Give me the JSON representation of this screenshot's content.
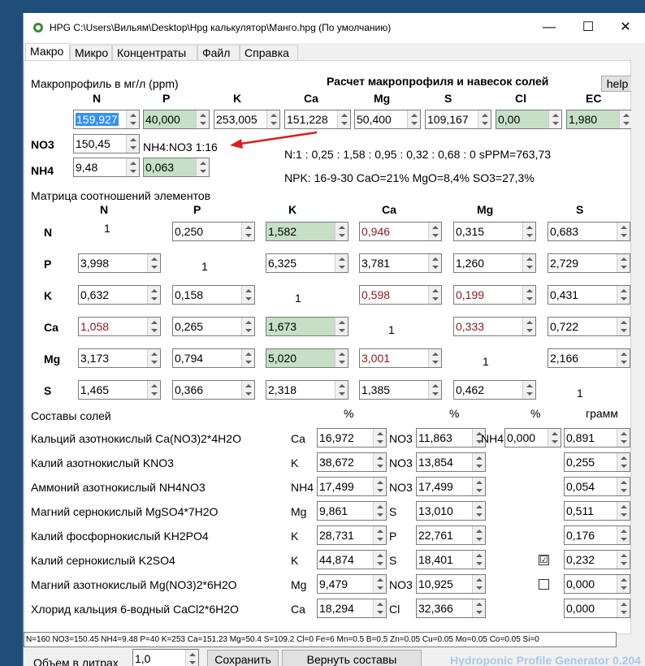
{
  "window": {
    "title": "HPG C:\\Users\\Вильям\\Desktop\\Hpg калькулятор\\Манго.hpg (По умолчанию)",
    "min": "—",
    "max": "☐",
    "close": "✕"
  },
  "tabs": [
    "Макро",
    "Микро",
    "Концентраты",
    "Файл",
    "Справка"
  ],
  "macro": {
    "profile_label": "Макропрофиль в мг/л (ppm)",
    "calc_title": "Расчет макропрофиля и навесок солей",
    "help": "help",
    "headers": [
      "N",
      "P",
      "K",
      "Ca",
      "Mg",
      "S",
      "Cl",
      "EC"
    ],
    "values": [
      "159,927",
      "40,000",
      "253,005",
      "151,228",
      "50,400",
      "109,167",
      "0,00",
      "1,980"
    ],
    "no3_label": "NO3",
    "no3_value": "150,45",
    "nh4_label": "NH4",
    "nh4_value": "9,48",
    "nh4_ratio_value": "0,063",
    "ratio_text": "NH4:NO3 1:16",
    "n_ratio": "N:1 : 0,25 : 1,58 : 0,95 : 0,32 : 0,68 : 0 sPPM=763,73",
    "npk": "NPK: 16-9-30 CaO=21% MgO=8,4% SO3=27,3%"
  },
  "matrix": {
    "title": "Матрица соотношений элементов",
    "cols": [
      "N",
      "P",
      "K",
      "Ca",
      "Mg",
      "S"
    ],
    "rows": [
      {
        "label": "N",
        "cells": [
          "1",
          "0,250",
          "1,582",
          "0,946",
          "0,315",
          "0,683"
        ]
      },
      {
        "label": "P",
        "cells": [
          "3,998",
          "1",
          "6,325",
          "3,781",
          "1,260",
          "2,729"
        ]
      },
      {
        "label": "K",
        "cells": [
          "0,632",
          "0,158",
          "1",
          "0,598",
          "0,199",
          "0,431"
        ]
      },
      {
        "label": "Ca",
        "cells": [
          "1,058",
          "0,265",
          "1,673",
          "1",
          "0,333",
          "0,722"
        ]
      },
      {
        "label": "Mg",
        "cells": [
          "3,173",
          "0,794",
          "5,020",
          "3,001",
          "1",
          "2,166"
        ]
      },
      {
        "label": "S",
        "cells": [
          "1,465",
          "0,366",
          "2,318",
          "1,385",
          "0,462",
          "1"
        ]
      }
    ]
  },
  "salts": {
    "title": "Составы солей",
    "pct1": "%",
    "pct2": "%",
    "pct3": "%",
    "gram": "грамм",
    "items": [
      {
        "name": "Кальций азотнокислый Ca(NO3)2*4H2O",
        "e1": "Ca",
        "v1": "16,972",
        "e2": "NO3",
        "v2": "11,863",
        "e3": "NH4",
        "v3": "0,000",
        "g": "0,891"
      },
      {
        "name": "Калий азотнокислый KNO3",
        "e1": "K",
        "v1": "38,672",
        "e2": "NO3",
        "v2": "13,854",
        "g": "0,255"
      },
      {
        "name": "Аммоний азотнокислый NH4NO3",
        "e1": "NH4",
        "v1": "17,499",
        "e2": "NO3",
        "v2": "17,499",
        "g": "0,054"
      },
      {
        "name": "Магний сернокислый MgSO4*7H2O",
        "e1": "Mg",
        "v1": "9,861",
        "e2": "S",
        "v2": "13,010",
        "g": "0,511"
      },
      {
        "name": "Калий фосфорнокислый KH2PO4",
        "e1": "K",
        "v1": "28,731",
        "e2": "P",
        "v2": "22,761",
        "g": "0,176"
      },
      {
        "name": "Калий сернокислый K2SO4",
        "e1": "K",
        "v1": "44,874",
        "e2": "S",
        "v2": "18,401",
        "chk": "☑",
        "g": "0,232"
      },
      {
        "name": "Магний азотнокислый Mg(NO3)2*6H2O",
        "e1": "Mg",
        "v1": "9,479",
        "e2": "NO3",
        "v2": "10,925",
        "chk": "",
        "g": "0,000"
      },
      {
        "name": "Хлорид кальция 6-водный CaCl2*6H2O",
        "e1": "Ca",
        "v1": "18,294",
        "e2": "Cl",
        "v2": "32,366",
        "g": "0,000"
      }
    ]
  },
  "status": "N=160 NO3=150.45 NH4=9.48 P=40 K=253 Ca=151.23 Mg=50.4 S=109.2 Cl=0 Fe=6 Mn=0.5 B=0.5 Zn=0.05 Cu=0.05 Mo=0.05 Co=0.05 Si=0",
  "bottom": {
    "volume_label": "Объем в литрах",
    "volume": "1,0",
    "save": "Сохранить",
    "restore": "Вернуть составы",
    "brand": "Hydroponic Profile Generator 0.204"
  }
}
